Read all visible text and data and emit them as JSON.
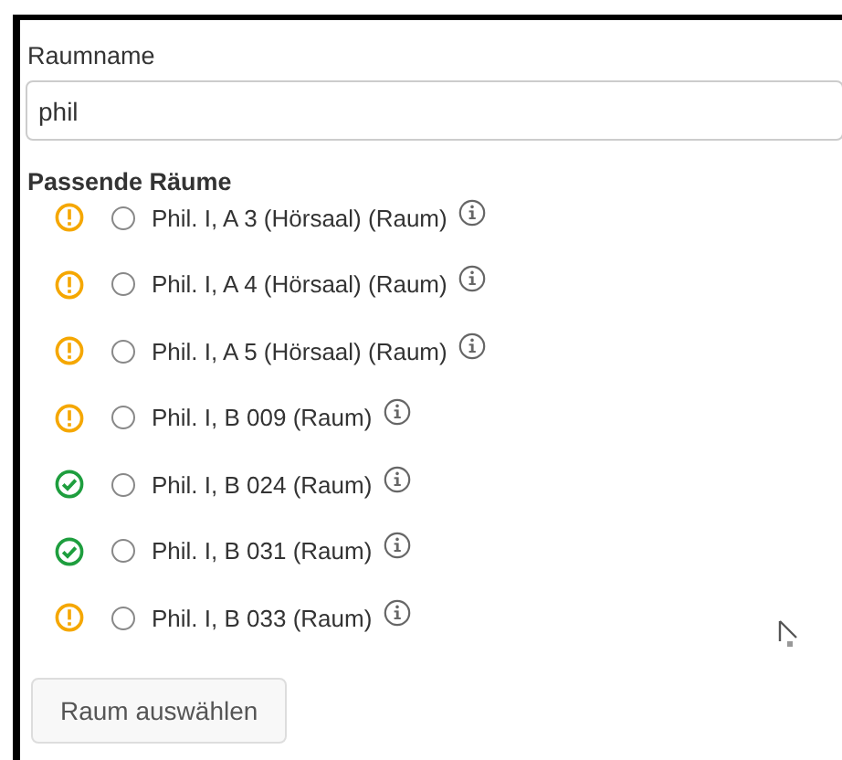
{
  "room_name": {
    "label": "Raumname",
    "value": "phil"
  },
  "matching_rooms": {
    "heading": "Passende Räume",
    "rooms": [
      {
        "name": "Phil. I, A 3 (Hörsaal) (Raum)",
        "kind": "warning",
        "selected": false
      },
      {
        "name": "Phil. I, A 4 (Hörsaal) (Raum)",
        "kind": "warning",
        "selected": false
      },
      {
        "name": "Phil. I, A 5 (Hörsaal) (Raum)",
        "kind": "warning",
        "selected": false
      },
      {
        "name": "Phil. I, B 009 (Raum)",
        "kind": "warning",
        "selected": false
      },
      {
        "name": "Phil. I, B 024 (Raum)",
        "kind": "ok",
        "selected": false
      },
      {
        "name": "Phil. I, B 031 (Raum)",
        "kind": "ok",
        "selected": false
      },
      {
        "name": "Phil. I, B 033 (Raum)",
        "kind": "warning",
        "selected": false
      }
    ]
  },
  "button": "Raum auswählen"
}
